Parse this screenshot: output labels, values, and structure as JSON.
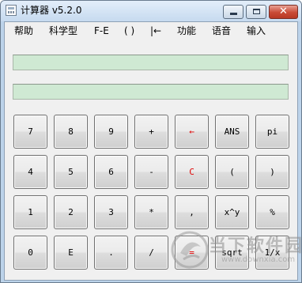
{
  "window": {
    "title": "计算器 v5.2.0",
    "close_glyph": "✕"
  },
  "menu": [
    "帮助",
    "科学型",
    "F-E",
    "( )",
    "|←",
    "功能",
    "语音",
    "输入"
  ],
  "display": {
    "expression": "",
    "result": ""
  },
  "keypad": {
    "rows": [
      [
        "7",
        "8",
        "9",
        "+",
        "←",
        "ANS",
        "pi"
      ],
      [
        "4",
        "5",
        "6",
        "-",
        "C",
        "(",
        ")"
      ],
      [
        "1",
        "2",
        "3",
        "*",
        ",",
        "x^y",
        "%"
      ],
      [
        "0",
        "E",
        ".",
        "/",
        "=",
        "sqrt",
        "1/x"
      ]
    ],
    "red_keys": [
      "←",
      "C",
      "="
    ],
    "red_color": "#e00000"
  },
  "watermark": {
    "title": "当下软件园",
    "url": "www.downxia.com"
  },
  "colors": {
    "display_bg": "#cfe9d3",
    "titlebar": "#c6daef",
    "close_button": "#c94a36"
  }
}
